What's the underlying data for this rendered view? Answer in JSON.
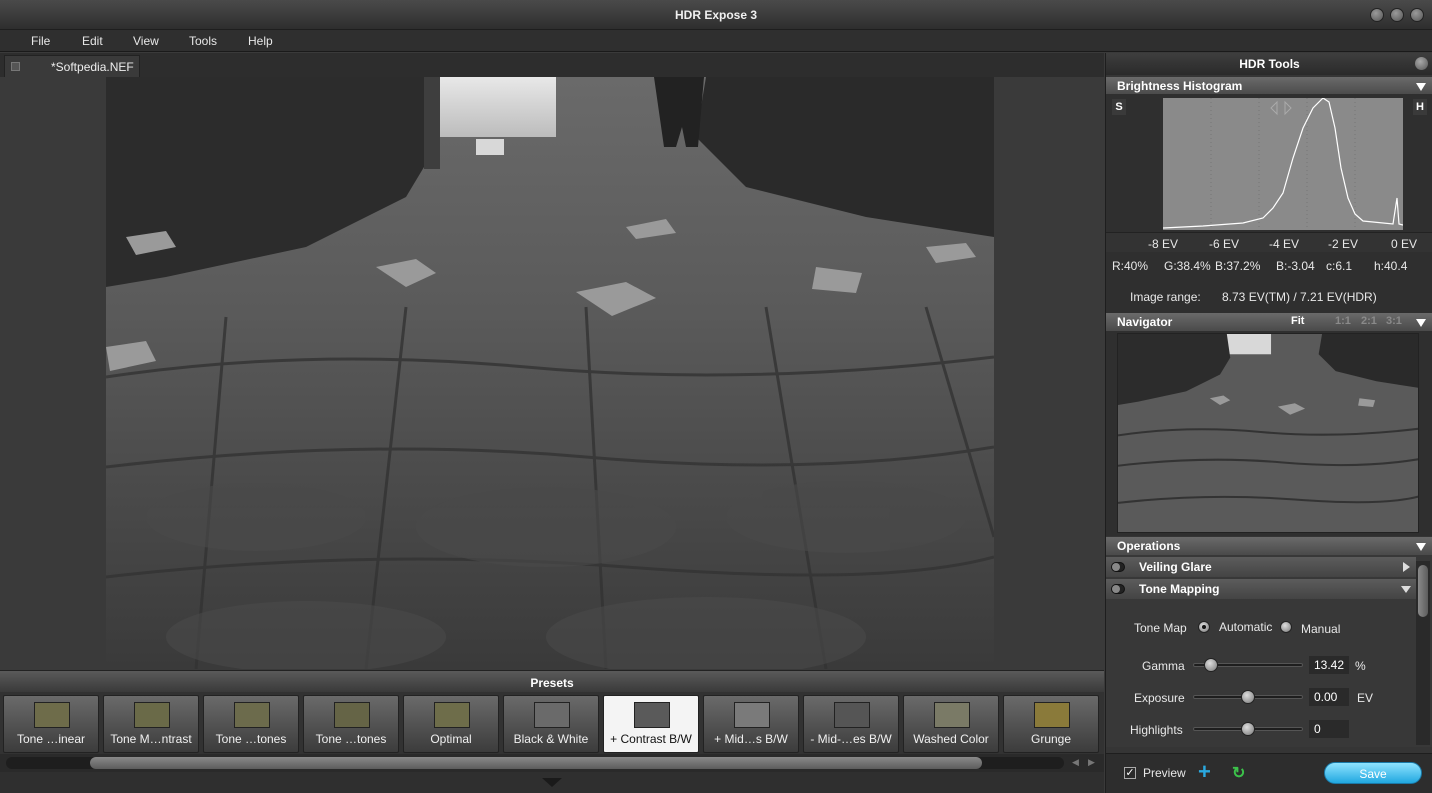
{
  "window": {
    "title": "HDR Expose 3"
  },
  "menu": [
    "File",
    "Edit",
    "View",
    "Tools",
    "Help"
  ],
  "tab": {
    "label": "*Softpedia.NEF"
  },
  "presets": {
    "header": "Presets",
    "items": [
      {
        "label": "Tone …inear",
        "thumb": "#6e6c4a"
      },
      {
        "label": "Tone M…ntrast",
        "thumb": "#6a6a48"
      },
      {
        "label": "Tone …tones",
        "thumb": "#6c6b4c"
      },
      {
        "label": "Tone …tones",
        "thumb": "#656446"
      },
      {
        "label": "Optimal",
        "thumb": "#6e6d4a"
      },
      {
        "label": "Black & White",
        "thumb": "#6a6a6a"
      },
      {
        "label": "+ Contrast B/W",
        "thumb": "#5a5a5a"
      },
      {
        "label": "+ Mid…s B/W",
        "thumb": "#7a7a7a"
      },
      {
        "label": "- Mid-…es B/W",
        "thumb": "#555555"
      },
      {
        "label": "Washed Color",
        "thumb": "#7a7a66"
      },
      {
        "label": "Grunge",
        "thumb": "#8a7a3a"
      }
    ]
  },
  "hdr_tools": {
    "title": "HDR Tools",
    "histogram": {
      "header": "Brightness Histogram",
      "shadow_btn": "S",
      "highlight_btn": "H",
      "ev_ticks": [
        "-8 EV",
        "-6 EV",
        "-4 EV",
        "-2 EV",
        "0 EV"
      ],
      "stats": {
        "r": "R:40%",
        "g": "G:38.4%",
        "b": "B:37.2%",
        "bev": "B:-3.04",
        "c": "c:6.1",
        "h": "h:40.4"
      },
      "range_label": "Image range:",
      "range_value": "8.73 EV(TM) / 7.21 EV(HDR)"
    },
    "navigator": {
      "header": "Navigator",
      "fit": "Fit",
      "z1": "1:1",
      "z2": "2:1",
      "z3": "3:1"
    },
    "operations": {
      "header": "Operations",
      "veiling_glare": "Veiling Glare",
      "tone_mapping": "Tone Mapping",
      "tone_map_label": "Tone Map",
      "automatic": "Automatic",
      "manual": "Manual",
      "gamma": {
        "label": "Gamma",
        "value": "13.42",
        "unit": "%"
      },
      "exposure": {
        "label": "Exposure",
        "value": "0.00",
        "unit": "EV"
      },
      "highlights": {
        "label": "Highlights",
        "value": "0"
      }
    },
    "footer": {
      "preview": "Preview",
      "save": "Save"
    }
  },
  "colors": {
    "accent": "#2aa9e0",
    "refresh": "#3cc24a"
  }
}
